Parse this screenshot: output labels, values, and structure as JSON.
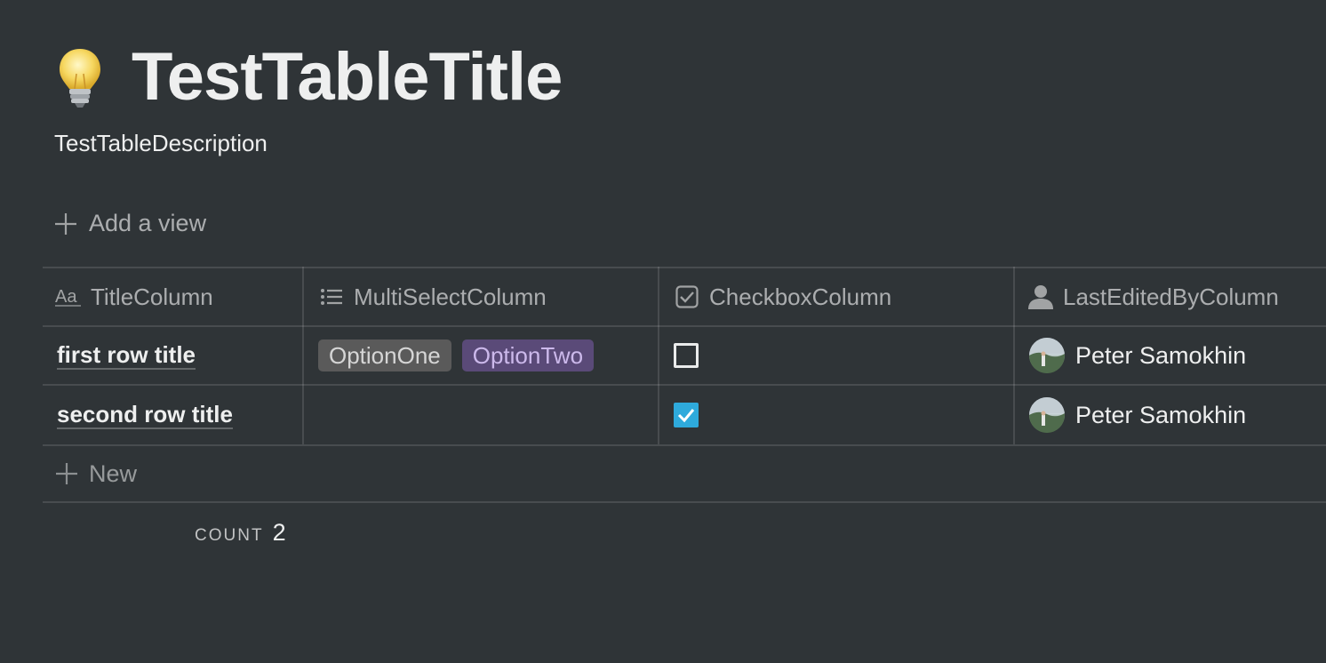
{
  "page": {
    "icon": "lightbulb-icon",
    "title": "TestTableTitle",
    "description": "TestTableDescription"
  },
  "views": {
    "add_view_label": "Add a view"
  },
  "table": {
    "columns": [
      {
        "label": "TitleColumn",
        "icon": "text-aa-icon"
      },
      {
        "label": "MultiSelectColumn",
        "icon": "list-icon"
      },
      {
        "label": "CheckboxColumn",
        "icon": "checkbox-icon"
      },
      {
        "label": "LastEditedByColumn",
        "icon": "person-icon"
      }
    ],
    "rows": [
      {
        "title": "first row title",
        "tags": [
          {
            "label": "OptionOne",
            "color": "#5a5a5a"
          },
          {
            "label": "OptionTwo",
            "color": "#5a4a78"
          }
        ],
        "checked": false,
        "edited_by": "Peter Samokhin"
      },
      {
        "title": "second row title",
        "tags": [],
        "checked": true,
        "edited_by": "Peter Samokhin"
      }
    ],
    "new_label": "New",
    "count_label": "COUNT",
    "count_value": "2"
  },
  "colors": {
    "background": "#2f3437",
    "checkbox_checked": "#2eaadc"
  }
}
